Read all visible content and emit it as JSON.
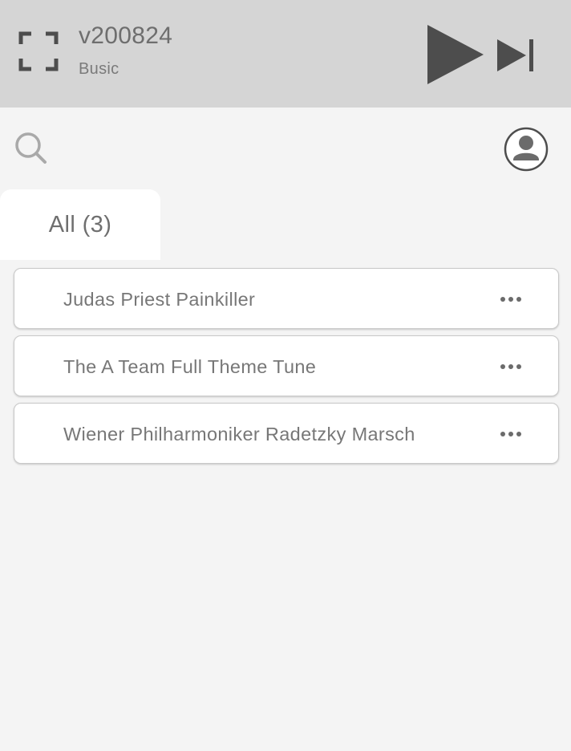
{
  "header": {
    "title": "v200824",
    "subtitle": "Busic",
    "icons": {
      "expand": "fullscreen-expand-icon",
      "play": "play-icon",
      "next": "skip-next-icon"
    }
  },
  "toolbar": {
    "icons": {
      "search": "search-icon",
      "account": "user-account-icon"
    }
  },
  "tabs": [
    {
      "label": "All (3)",
      "selected": true
    }
  ],
  "tracks": [
    {
      "title": "Judas Priest Painkiller",
      "more_icon": "more-options-icon"
    },
    {
      "title": "The A Team Full Theme Tune",
      "more_icon": "more-options-icon"
    },
    {
      "title": "Wiener Philharmoniker Radetzky Marsch",
      "more_icon": "more-options-icon"
    }
  ],
  "colors": {
    "header_bg": "#d5d5d5",
    "page_bg": "#f4f4f4",
    "icon_dark": "#4d4d4d",
    "text_gray": "#777777"
  }
}
